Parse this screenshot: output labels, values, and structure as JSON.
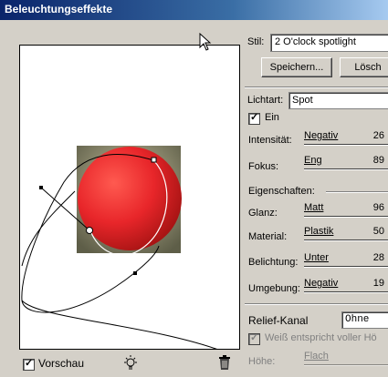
{
  "window": {
    "title": "Beleuchtungseffekte"
  },
  "style": {
    "label": "Stil:",
    "value": "2 O'clock spotlight",
    "save_button": "Speichern...",
    "delete_button": "Lösch"
  },
  "light": {
    "type_label": "Lichtart:",
    "type_value": "Spot",
    "on_label": "Ein",
    "on_checked": true,
    "intensity": {
      "label": "Intensität:",
      "slider_label": "Negativ",
      "value": "26"
    },
    "focus": {
      "label": "Fokus:",
      "slider_label": "Eng",
      "value": "89"
    }
  },
  "properties": {
    "header": "Eigenschaften:",
    "gloss": {
      "label": "Glanz:",
      "slider_label": "Matt",
      "value": "96"
    },
    "material": {
      "label": "Material:",
      "slider_label": "Plastik",
      "value": "50"
    },
    "exposure": {
      "label": "Belichtung:",
      "slider_label": "Unter",
      "value": "28"
    },
    "ambience": {
      "label": "Umgebung:",
      "slider_label": "Negativ",
      "value": "19"
    }
  },
  "relief": {
    "channel_label": "Relief-Kanal",
    "channel_value": "Ohne",
    "white_high_label": "Weiß entspricht voller Hö",
    "height_label": "Höhe:",
    "height_slider_label": "Flach"
  },
  "preview_bar": {
    "preview_label": "Vorschau",
    "preview_checked": true,
    "light_icon": "light-bulb-icon",
    "trash_icon": "trash-icon"
  },
  "colors": {
    "sphere": "#e8262a",
    "square": "#7a7a62",
    "title_bar": "#0a246a"
  }
}
